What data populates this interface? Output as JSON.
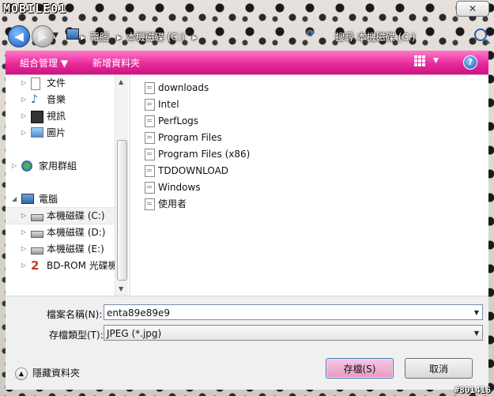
{
  "app": {
    "logo": "MOBILE01",
    "close_glyph": "✕",
    "watermark": "#801416"
  },
  "nav": {
    "crumbs": [
      "電腦",
      "本機磁碟 (C:)"
    ],
    "search_placeholder": "搜尋 本機磁碟 (C:)"
  },
  "toolbar": {
    "organize": "組合管理 ▼",
    "new_folder": "新增資料夾",
    "help": "?"
  },
  "sidebar": {
    "items": [
      {
        "label": "文件",
        "icon": "document-icon"
      },
      {
        "label": "音樂",
        "icon": "music-icon"
      },
      {
        "label": "視訊",
        "icon": "video-icon"
      },
      {
        "label": "圖片",
        "icon": "picture-icon"
      },
      {
        "label": "家用群組",
        "icon": "homegroup-icon"
      },
      {
        "label": "電腦",
        "icon": "computer-icon"
      },
      {
        "label": "本機磁碟 (C:)",
        "icon": "drive-c-icon"
      },
      {
        "label": "本機磁碟 (D:)",
        "icon": "drive-icon"
      },
      {
        "label": "本機磁碟 (E:)",
        "icon": "drive-icon"
      },
      {
        "label": "BD-ROM 光碟機",
        "icon": "bd-rom-icon"
      }
    ]
  },
  "files": [
    "downloads",
    "Intel",
    "PerfLogs",
    "Program Files",
    "Program Files (x86)",
    "TDDOWNLOAD",
    "Windows",
    "使用者"
  ],
  "form": {
    "filename_label": "檔案名稱(N):",
    "filename_value": "enta89e89e9",
    "filetype_label": "存檔類型(T):",
    "filetype_value": "JPEG (*.jpg)",
    "hide_folders": "隱藏資料夾",
    "save": "存檔(S)",
    "cancel": "取消"
  },
  "colors": {
    "accent": "#ea2a9c",
    "save_button": "#e79ac6"
  }
}
